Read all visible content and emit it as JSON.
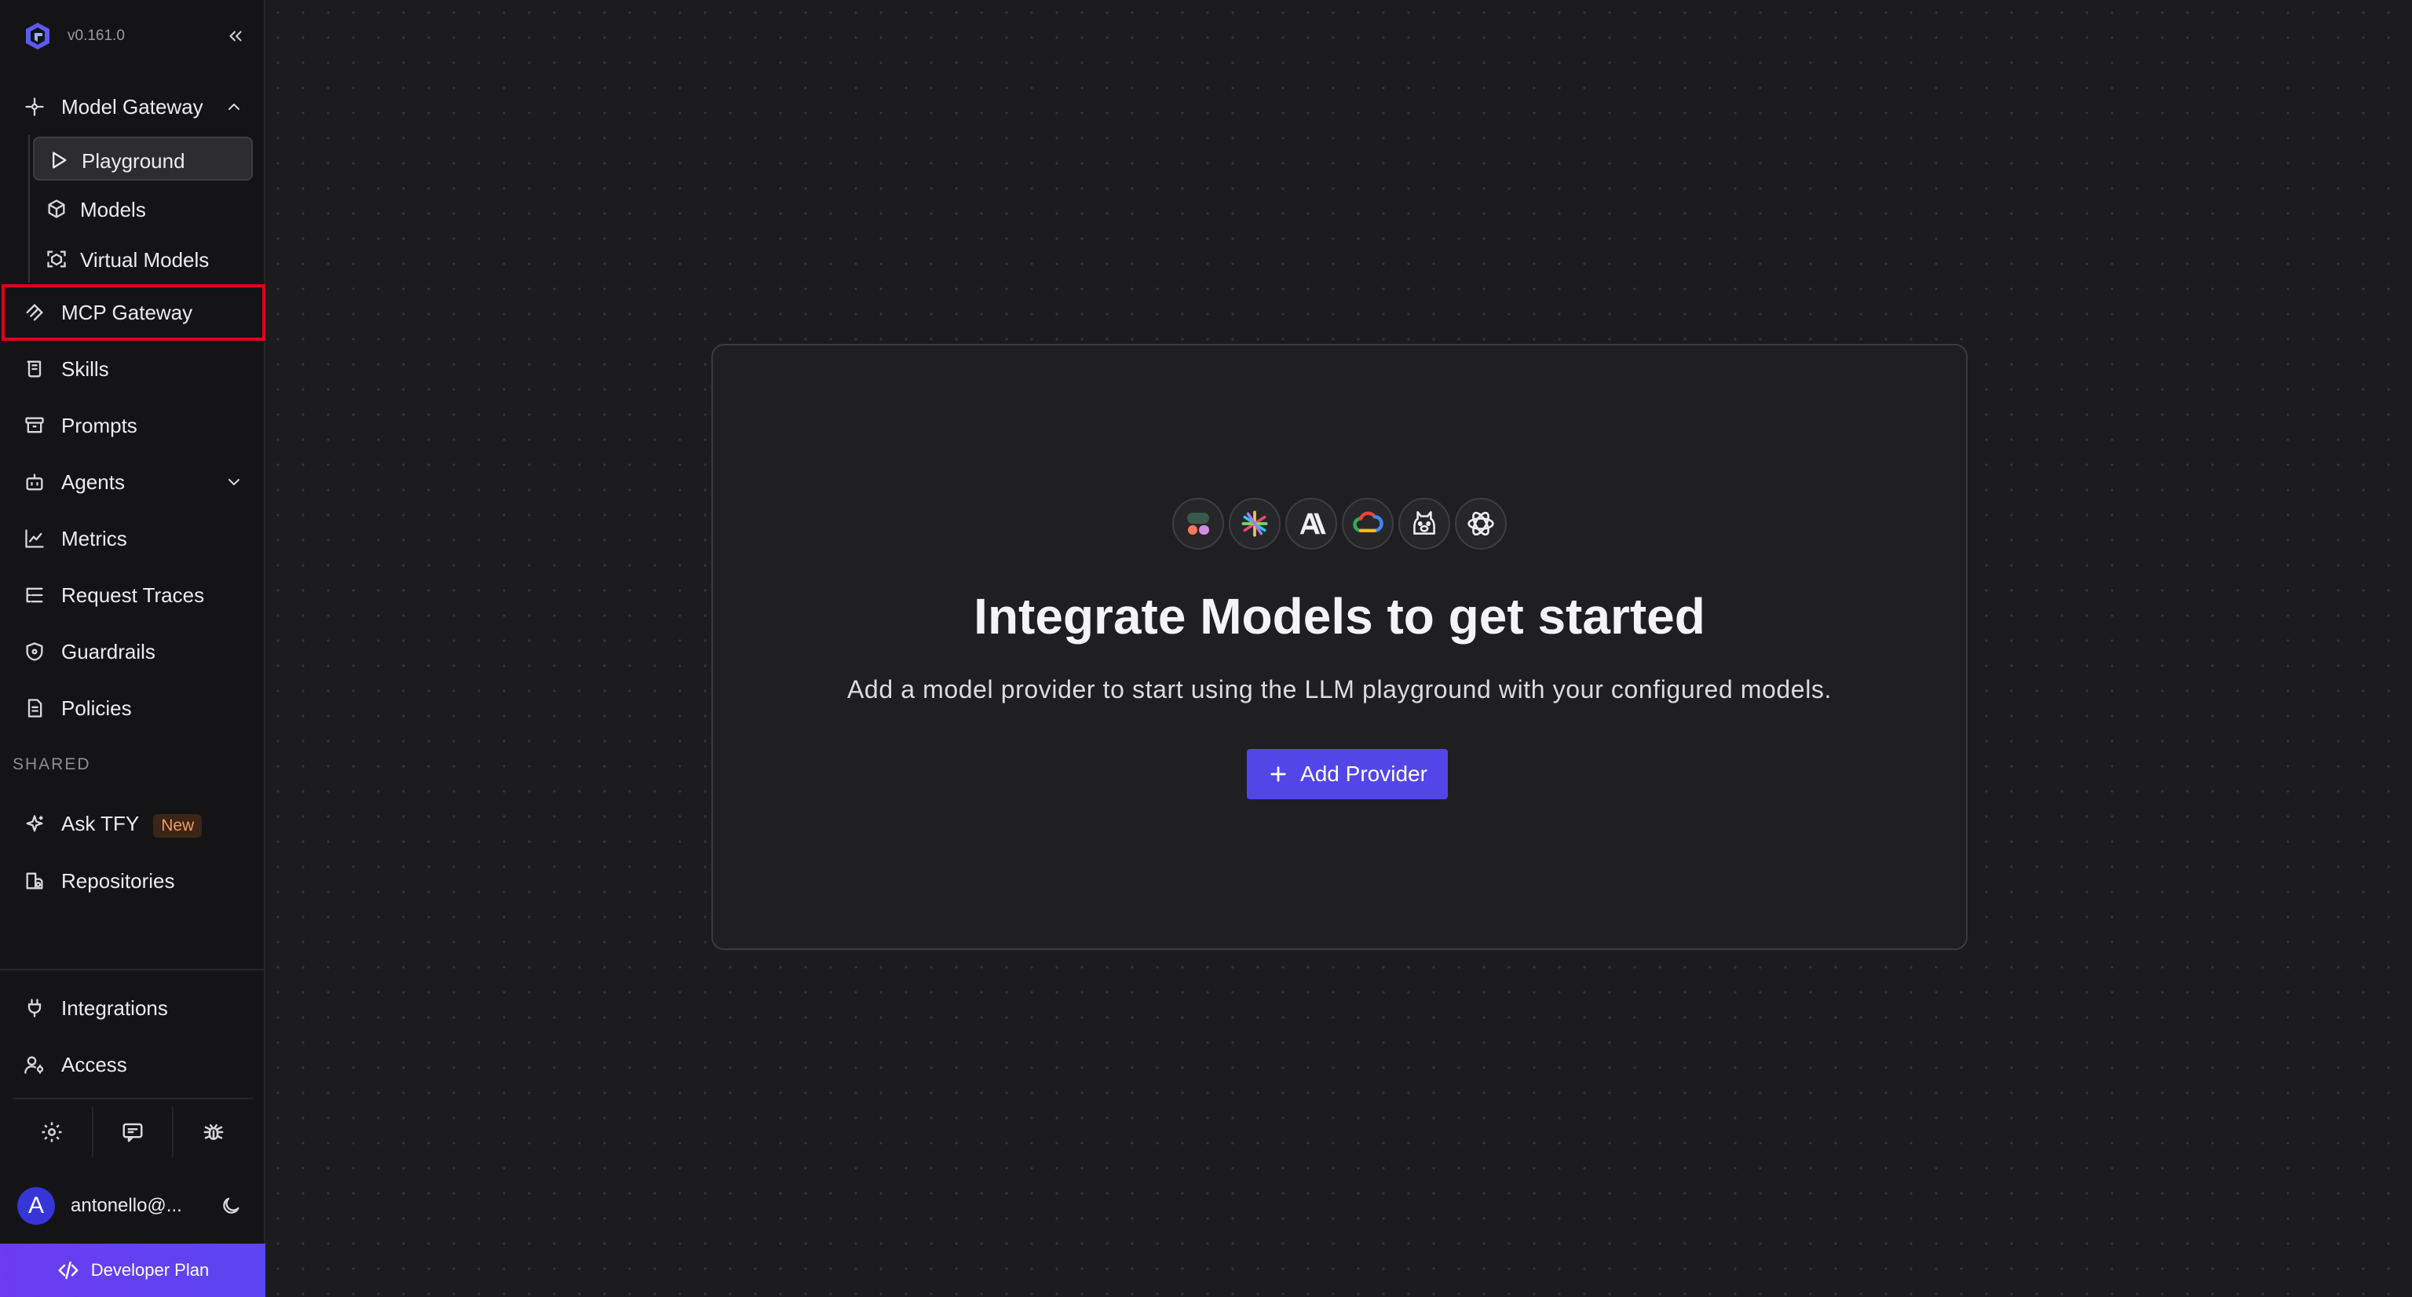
{
  "app": {
    "version": "v0.161.0"
  },
  "sidebar": {
    "groups": {
      "model_gateway": {
        "label": "Model Gateway",
        "children": [
          {
            "label": "Playground",
            "active": true
          },
          {
            "label": "Models"
          },
          {
            "label": "Virtual Models"
          }
        ]
      }
    },
    "items": [
      {
        "label": "MCP Gateway",
        "highlighted": true
      },
      {
        "label": "Skills"
      },
      {
        "label": "Prompts"
      },
      {
        "label": "Agents"
      },
      {
        "label": "Metrics"
      },
      {
        "label": "Request Traces"
      },
      {
        "label": "Guardrails"
      },
      {
        "label": "Policies"
      }
    ],
    "shared_section": {
      "label": "SHARED",
      "items": [
        {
          "label": "Ask TFY",
          "badge": "New"
        },
        {
          "label": "Repositories"
        }
      ]
    },
    "bottom_items": [
      {
        "label": "Integrations"
      },
      {
        "label": "Access"
      }
    ],
    "tools": [
      "settings-icon",
      "feedback-icon",
      "bug-icon"
    ],
    "user": {
      "initial": "A",
      "name": "antonello@..."
    },
    "plan": {
      "label": "Developer Plan"
    }
  },
  "main": {
    "providers": [
      "cohere-icon",
      "perplexity-icon",
      "anthropic-icon",
      "google-cloud-icon",
      "ollama-icon",
      "openai-icon"
    ],
    "title": "Integrate Models to get started",
    "subtitle": "Add a model provider to start using the LLM playground with your configured models.",
    "cta_label": "Add Provider"
  },
  "colors": {
    "accent": "#5346e8",
    "highlight_border": "#e0001b",
    "badge_text": "#f29a62",
    "plan_gradient_start": "#6b3cf0"
  }
}
